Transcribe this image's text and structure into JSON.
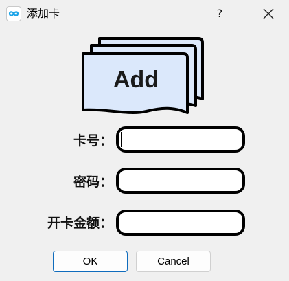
{
  "window": {
    "title": "添加卡",
    "icon": "infinity-icon",
    "help_label": "?",
    "close_icon": "close-icon"
  },
  "graphic": {
    "label": "Add",
    "icon": "stacked-cards-icon",
    "fill_color": "#dbe8fb",
    "stroke_color": "#000000"
  },
  "form": {
    "card_number_label": "卡号：",
    "card_number_value": "",
    "password_label": "密码：",
    "password_value": "",
    "opening_amount_label": "开卡金额：",
    "opening_amount_value": ""
  },
  "buttons": {
    "ok_label": "OK",
    "cancel_label": "Cancel",
    "ok_border_color": "#0f6cbd"
  }
}
